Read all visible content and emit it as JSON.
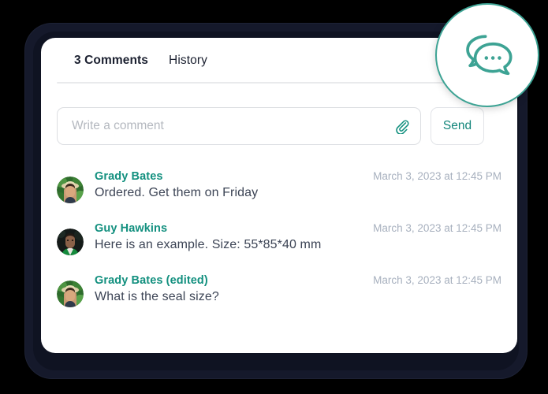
{
  "tabs": [
    {
      "label": "3 Comments",
      "active": true
    },
    {
      "label": "History",
      "active": false
    }
  ],
  "composer": {
    "placeholder": "Write a comment",
    "value": "",
    "attach_icon": "paperclip-icon",
    "send_label": "Send"
  },
  "comments": [
    {
      "author": "Grady Bates",
      "text": "Ordered. Get them on Friday",
      "timestamp": "March 3, 2023 at 12:45 PM",
      "avatar": "woman-straw-hat-greenery-avatar"
    },
    {
      "author": "Guy Hawkins",
      "text": "Here is an example. Size: 55*85*40 mm",
      "timestamp": "March 3, 2023 at 12:45 PM",
      "avatar": "man-green-shirt-avatar"
    },
    {
      "author": "Grady Bates (edited)",
      "text": "What is the seal size?",
      "timestamp": "March 3, 2023 at 12:45 PM",
      "avatar": "woman-straw-hat-greenery-avatar"
    }
  ],
  "badge": {
    "icon": "chat-bubbles-icon"
  },
  "colors": {
    "accent_teal": "#13907f",
    "badge_border": "#3da394",
    "bezel": "#15192b",
    "text_dark": "#1b2030",
    "text_body": "#3c4455",
    "timestamp": "#a7b0be",
    "placeholder": "#b4b8bf",
    "border_light": "#dcdee2",
    "divider": "#e9eaec",
    "background": "#000000"
  }
}
